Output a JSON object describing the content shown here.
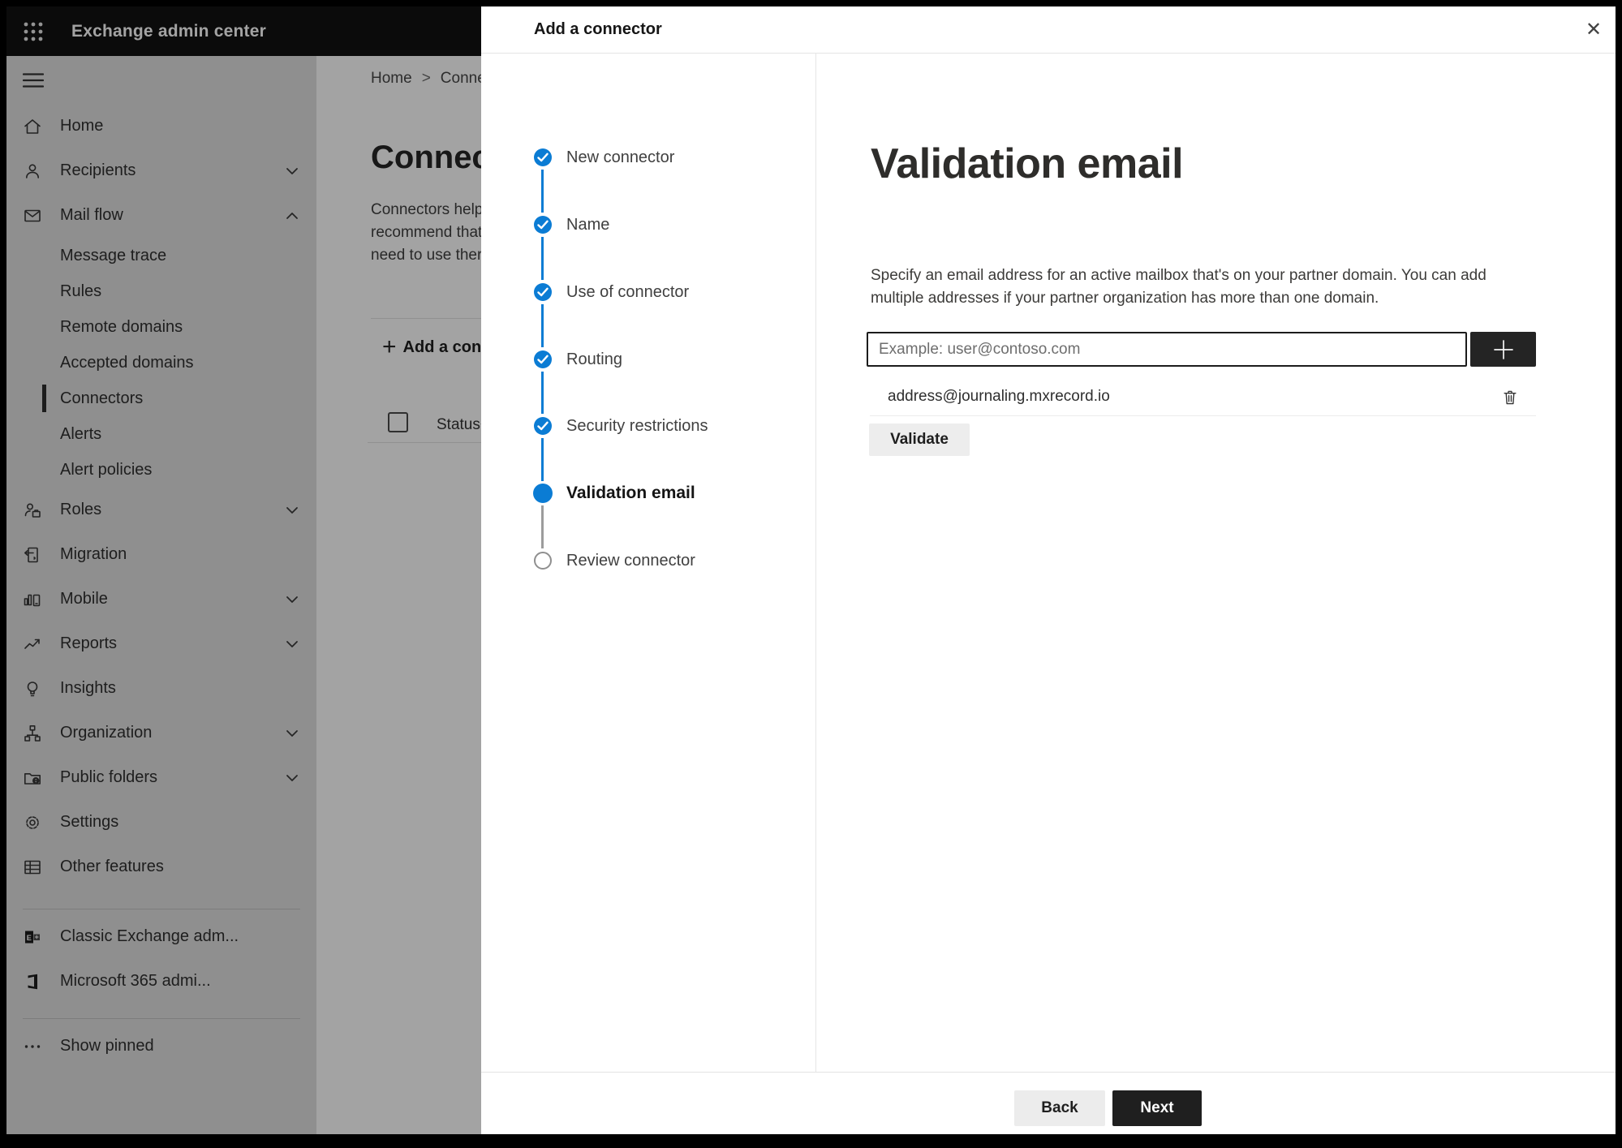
{
  "app_bar": {
    "title": "Exchange admin center",
    "waffle_icon": "apps-grid-icon"
  },
  "sidebar": {
    "items": [
      {
        "type": "item",
        "label": "Home",
        "icon": "home"
      },
      {
        "type": "item",
        "label": "Recipients",
        "icon": "person",
        "chevron": "down"
      },
      {
        "type": "item",
        "label": "Mail flow",
        "icon": "mail",
        "chevron": "up"
      },
      {
        "type": "sub",
        "label": "Message trace"
      },
      {
        "type": "sub",
        "label": "Rules"
      },
      {
        "type": "sub",
        "label": "Remote domains"
      },
      {
        "type": "sub",
        "label": "Accepted domains"
      },
      {
        "type": "sub",
        "label": "Connectors",
        "selected": true
      },
      {
        "type": "sub",
        "label": "Alerts"
      },
      {
        "type": "sub",
        "label": "Alert policies"
      },
      {
        "type": "item",
        "label": "Roles",
        "icon": "person-badge",
        "chevron": "down"
      },
      {
        "type": "item",
        "label": "Migration",
        "icon": "migration"
      },
      {
        "type": "item",
        "label": "Mobile",
        "icon": "mobile",
        "chevron": "down"
      },
      {
        "type": "item",
        "label": "Reports",
        "icon": "chart",
        "chevron": "down"
      },
      {
        "type": "item",
        "label": "Insights",
        "icon": "bulb"
      },
      {
        "type": "item",
        "label": "Organization",
        "icon": "org",
        "chevron": "down"
      },
      {
        "type": "item",
        "label": "Public folders",
        "icon": "folder-globe",
        "chevron": "down"
      },
      {
        "type": "item",
        "label": "Settings",
        "icon": "gear"
      },
      {
        "type": "item",
        "label": "Other features",
        "icon": "table-grid"
      },
      {
        "type": "divider"
      },
      {
        "type": "item",
        "label": "Classic Exchange adm...",
        "icon": "exchange-logo"
      },
      {
        "type": "item",
        "label": "Microsoft 365 admi...",
        "icon": "m365-logo"
      },
      {
        "type": "divider"
      },
      {
        "type": "item",
        "label": "Show pinned",
        "icon": "ellipsis"
      }
    ]
  },
  "page": {
    "breadcrumb": [
      "Home",
      "Conne"
    ],
    "breadcrumb_separator": ">",
    "heading": "Connec",
    "paragraph_lines": [
      "Connectors help",
      "recommend that",
      "need to use ther"
    ],
    "add_button_label": "Add a conn",
    "table_header_status": "Status"
  },
  "dialog": {
    "title": "Add a connector",
    "close_icon": "✕",
    "steps": [
      {
        "label": "New connector",
        "state": "done"
      },
      {
        "label": "Name",
        "state": "done"
      },
      {
        "label": "Use of connector",
        "state": "done"
      },
      {
        "label": "Routing",
        "state": "done"
      },
      {
        "label": "Security restrictions",
        "state": "done"
      },
      {
        "label": "Validation email",
        "state": "current"
      },
      {
        "label": "Review connector",
        "state": "todo"
      }
    ],
    "content": {
      "heading": "Validation email",
      "description_line1": "Specify an email address for an active mailbox that's on your partner domain. You can add",
      "description_line2": "multiple addresses if your partner organization has more than one domain.",
      "email_placeholder": "Example: user@contoso.com",
      "email_value": "",
      "addresses": [
        "address@journaling.mxrecord.io"
      ],
      "validate_label": "Validate"
    },
    "footer": {
      "back_label": "Back",
      "next_label": "Next"
    }
  },
  "colors": {
    "accent_blue": "#0b7cd4",
    "dark_button": "#242424",
    "topbar_black": "#121212"
  }
}
